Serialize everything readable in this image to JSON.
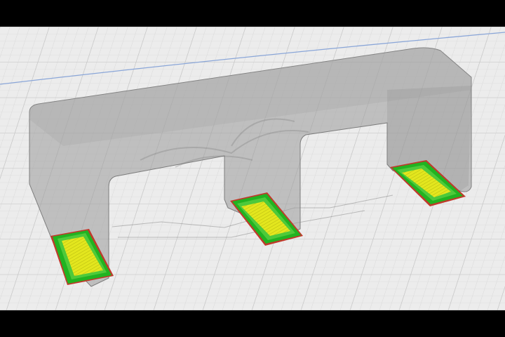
{
  "viewer": {
    "kind": "3D print slicer preview",
    "background": "#000000",
    "build_plate": {
      "fill": "#ececec",
      "fine_grid_color": "#d9d9d9",
      "major_grid_color": "#c4c4c4",
      "edge_line_color": "#8aa6d8"
    },
    "model": {
      "shell_color": "#9a9a9a",
      "shell_opacity": 0.55,
      "outline_color": "#7c7c7c"
    },
    "layer_colors": {
      "skirt": "#c0392b",
      "outer_wall": "#21b321",
      "inner_wall": "#4ec93b",
      "infill": "#e3e61e",
      "infill_hatch": "#b7b90f"
    },
    "footprints": [
      "left-leg",
      "middle-leg",
      "right-leg"
    ]
  }
}
